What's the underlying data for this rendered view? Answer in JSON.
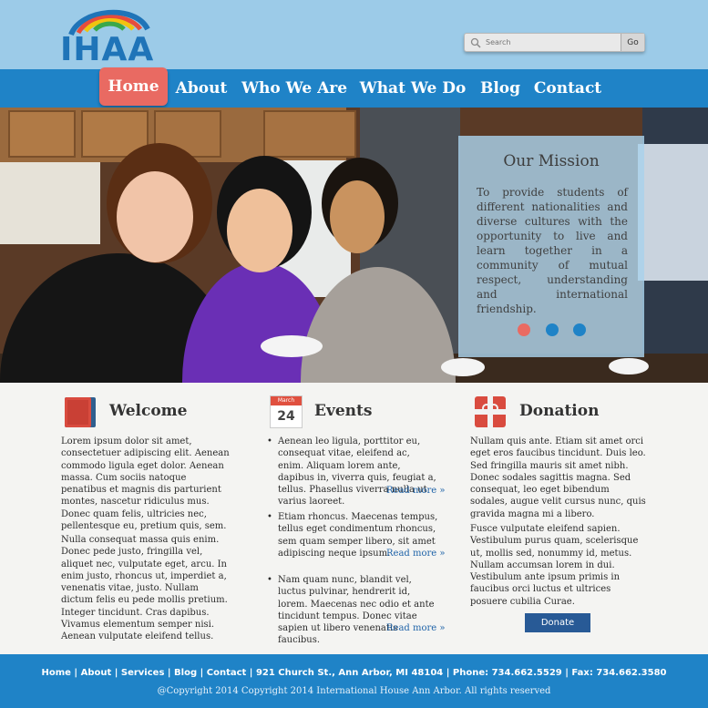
{
  "logo": {
    "text": "IHAA"
  },
  "search": {
    "placeholder": "Search",
    "button_label": "Go"
  },
  "nav": {
    "items": [
      {
        "label": "Home",
        "active": true
      },
      {
        "label": "About"
      },
      {
        "label": "Who We Are"
      },
      {
        "label": "What We Do"
      },
      {
        "label": "Blog"
      },
      {
        "label": "Contact"
      }
    ]
  },
  "mission": {
    "title": "Our Mission",
    "text": "To provide students of different nationalities and diverse cultures with the opportunity to live and learn together in a community of mutual respect, understanding and international friendship.",
    "slider_dots": 3
  },
  "welcome": {
    "title": "Welcome",
    "paragraphs": [
      "Lorem ipsum dolor sit amet, consectetuer adipiscing elit. Aenean commodo ligula eget dolor. Aenean massa. Cum sociis natoque penatibus et magnis dis parturient montes, nascetur ridiculus mus. Donec quam felis, ultricies nec, pellentesque eu, pretium quis, sem.",
      "Nulla consequat massa quis enim. Donec pede justo, fringilla vel, aliquet nec, vulputate eget, arcu. In enim justo, rhoncus ut, imperdiet a, venenatis vitae, justo. Nullam dictum felis eu pede mollis pretium. Integer tincidunt. Cras dapibus. Vivamus elementum semper nisi. Aenean vulputate eleifend tellus."
    ]
  },
  "events": {
    "title": "Events",
    "calendar": {
      "month": "March",
      "day": "24"
    },
    "items": [
      "Aenean leo ligula, porttitor eu, consequat vitae, eleifend ac, enim. Aliquam lorem ante, dapibus in, viverra quis, feugiat a, tellus. Phasellus viverra nulla ut varius laoreet.",
      "Etiam rhoncus. Maecenas tempus, tellus eget condimentum rhoncus, sem quam semper libero, sit amet adipiscing neque ipsum.",
      "Nam quam nunc, blandit vel, luctus pulvinar, hendrerit id, lorem. Maecenas nec odio et ante tincidunt tempus. Donec vitae sapien ut libero venenatis faucibus."
    ],
    "read_more": "Read more »"
  },
  "donation": {
    "title": "Donation",
    "paragraphs": [
      "Nullam quis ante. Etiam sit amet orci eget eros faucibus tincidunt. Duis leo. Sed fringilla mauris sit amet nibh. Donec sodales sagittis magna. Sed consequat, leo eget bibendum sodales, augue velit cursus nunc, quis gravida magna mi a libero.",
      "Fusce vulputate eleifend sapien. Vestibulum purus quam, scelerisque ut, mollis sed, nonummy id, metus. Nullam accumsan lorem in dui. Vestibulum ante ipsum primis in faucibus orci luctus et ultrices posuere cubilia Curae."
    ],
    "button_label": "Donate"
  },
  "footer": {
    "links": [
      "Home",
      "About",
      "Services",
      "Blog",
      "Contact"
    ],
    "address": "921 Church St., Ann Arbor, MI 48104",
    "phone": "Phone: 734.662.5529",
    "fax": "Fax: 734.662.3580",
    "copyright": "@Copyright 2014 Copyright 2014 International House Ann Arbor. All rights reserved"
  },
  "colors": {
    "header_bg": "#9ccbe8",
    "nav_bg": "#1f83c7",
    "nav_active": "#e96a62",
    "dot_active": "#e96a62",
    "dot_inactive": "#1f83c7",
    "link": "#1f63a8",
    "donate_button": "#285a96"
  }
}
